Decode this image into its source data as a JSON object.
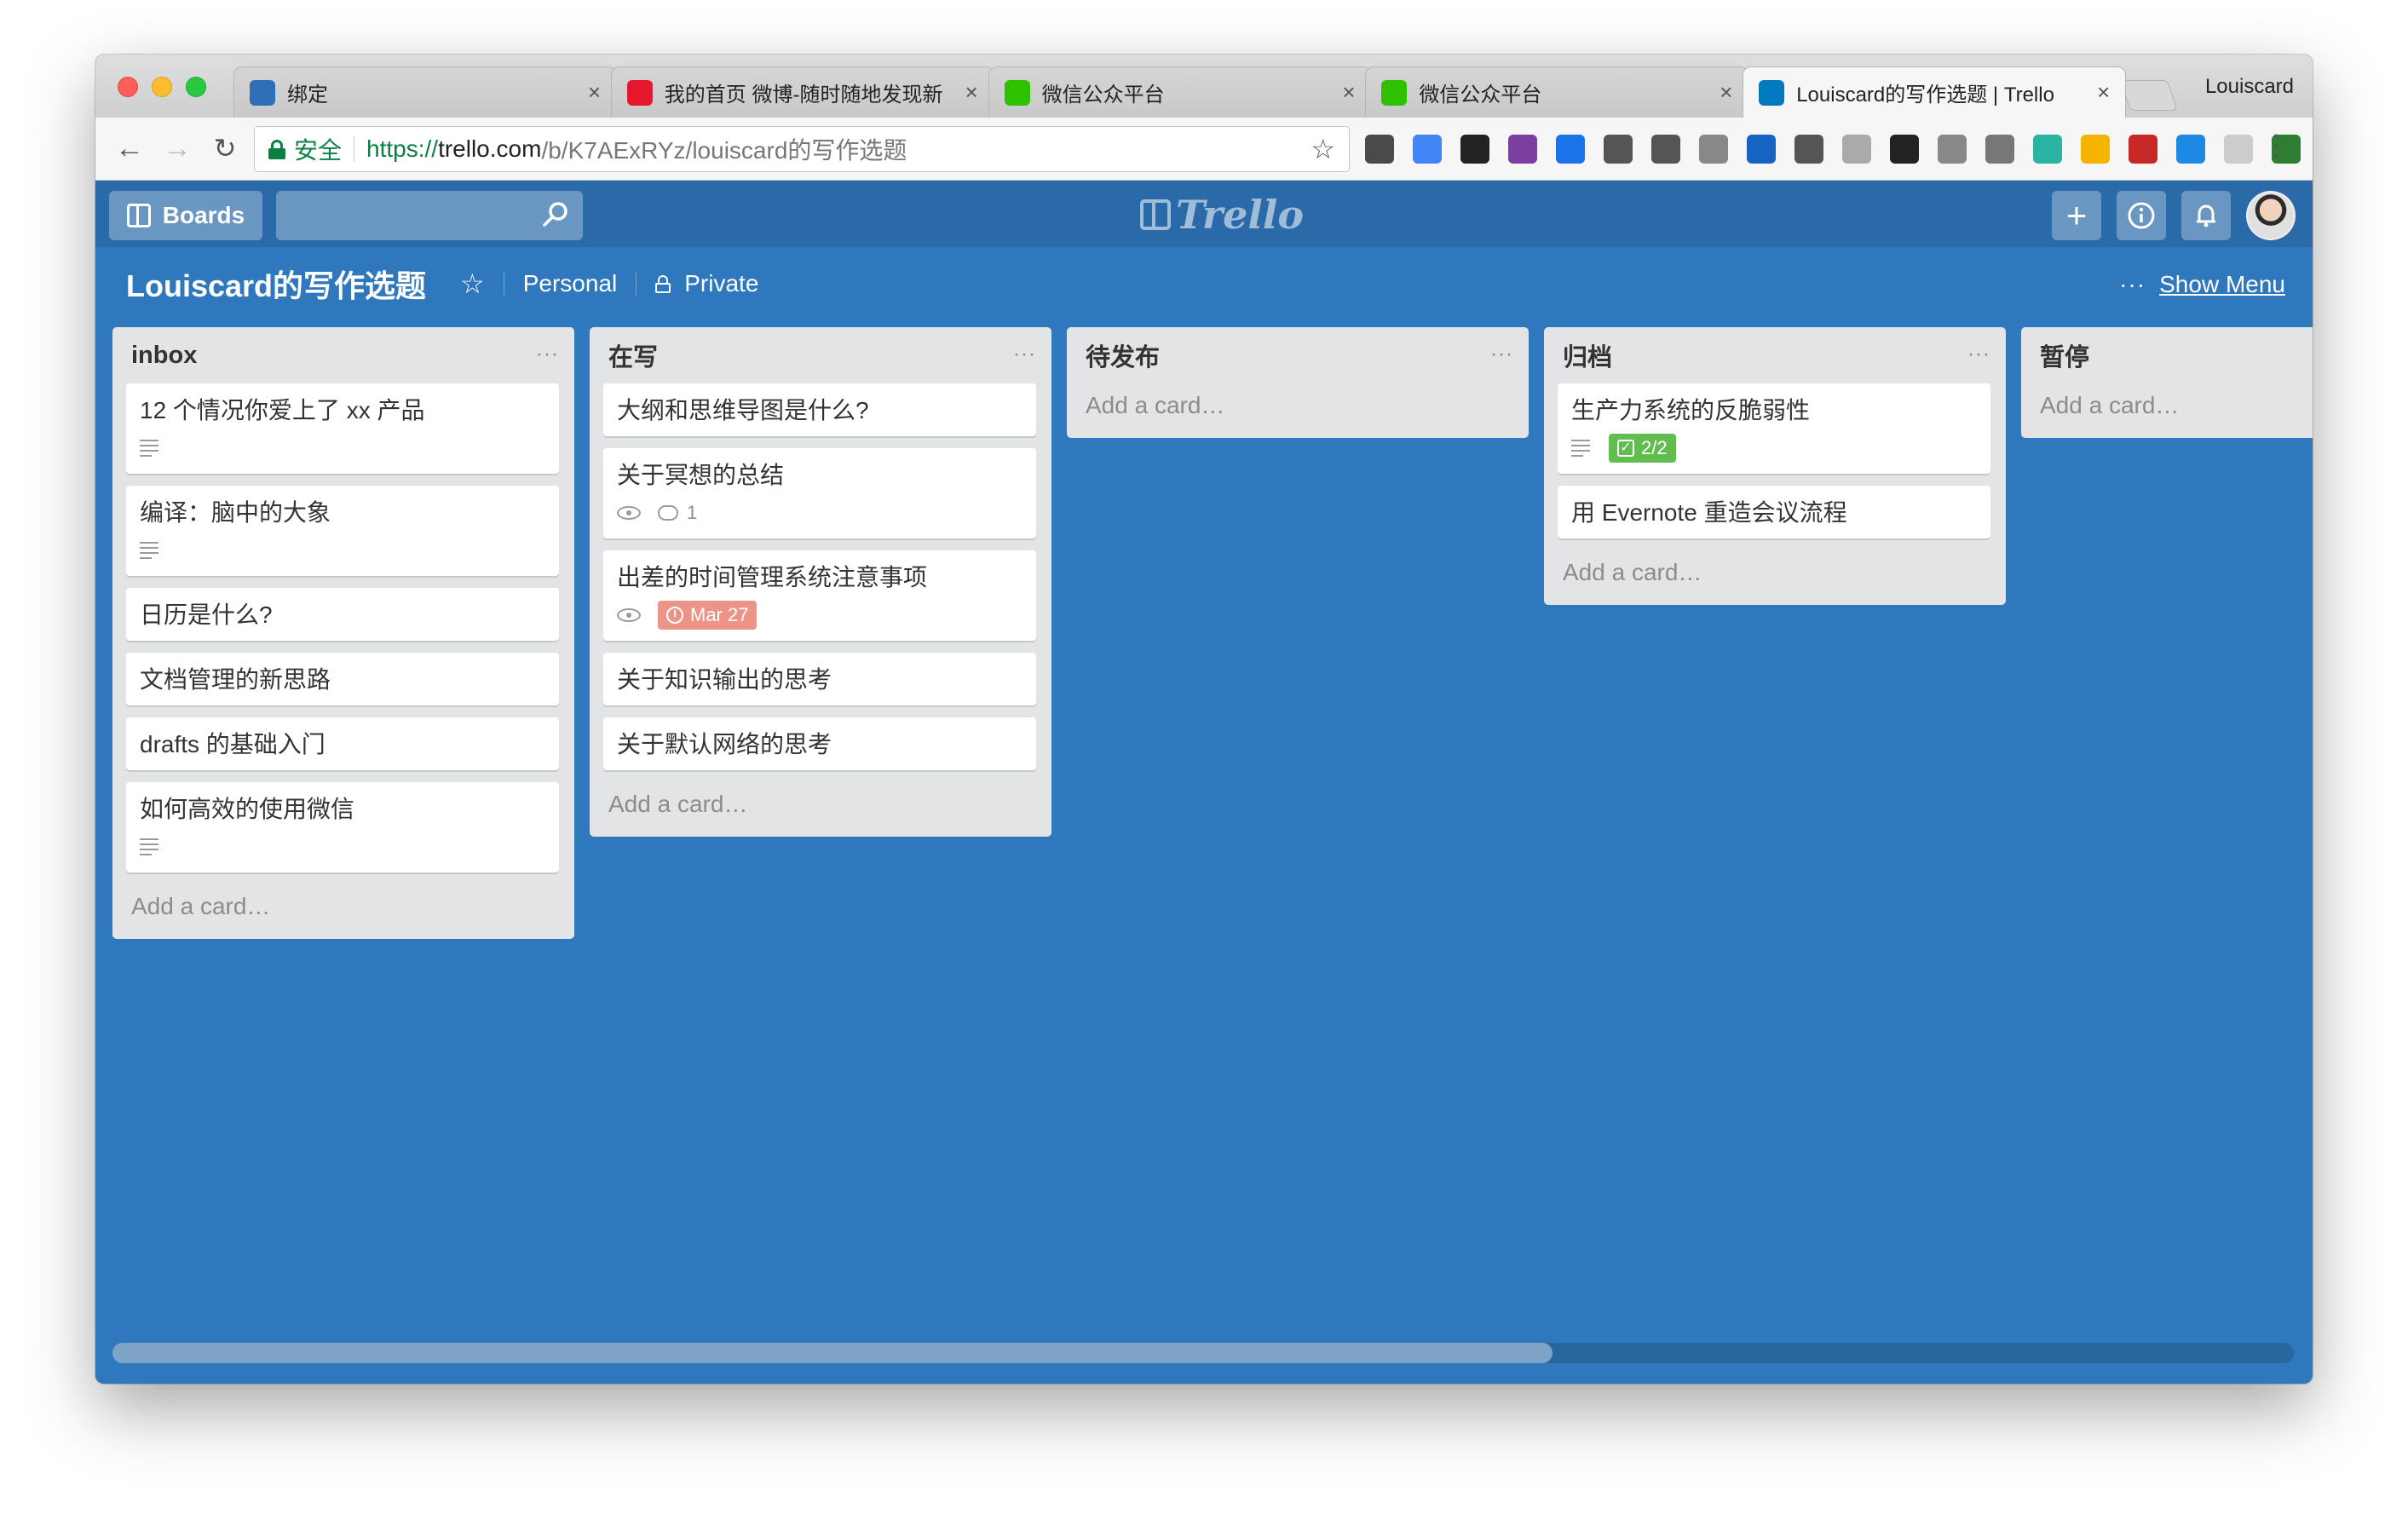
{
  "browser": {
    "tabs": [
      {
        "title": "绑定",
        "favicon_color": "#2f6fb7",
        "active": false
      },
      {
        "title": "我的首页 微博-随时随地发现新",
        "favicon_color": "#e6162d",
        "active": false
      },
      {
        "title": "微信公众平台",
        "favicon_color": "#2dc100",
        "active": false
      },
      {
        "title": "微信公众平台",
        "favicon_color": "#2dc100",
        "active": false
      },
      {
        "title": "Louiscard的写作选题 | Trello",
        "favicon_color": "#0079bf",
        "active": true
      }
    ],
    "close_glyph": "×",
    "profile_name": "Louiscard",
    "secure_label": "安全",
    "url_scheme": "https://",
    "url_host": "trello.com",
    "url_path": "/b/K7AExRYz/louiscard的写作选题",
    "extensions": [
      "evernote-icon",
      "translate-icon",
      "wechat-icon",
      "onenote-icon",
      "chrome-icon",
      "onepassword-icon",
      "lightbulb-icon",
      "reader-icon",
      "vimium-icon",
      "cloud-icon",
      "tab-icon",
      "instapaper-icon",
      "drive-icon",
      "inbox-icon",
      "refresh-icon",
      "folder-icon",
      "adblock-icon",
      "sync-icon",
      "shield-icon",
      "flag-icon",
      "trello-icon"
    ]
  },
  "trello": {
    "boards_label": "Boards",
    "logo_text": "Trello"
  },
  "board": {
    "title": "Louiscard的写作选题",
    "team": "Personal",
    "visibility": "Private",
    "show_menu": "Show Menu",
    "menu_dots": "···"
  },
  "lists": [
    {
      "title": "inbox",
      "cards": [
        {
          "title": "12 个情况你爱上了 xx 产品",
          "desc": true
        },
        {
          "title": "编译：脑中的大象",
          "desc": true
        },
        {
          "title": "日历是什么?"
        },
        {
          "title": "文档管理的新思路"
        },
        {
          "title": "drafts 的基础入门"
        },
        {
          "title": "如何高效的使用微信",
          "desc": true
        }
      ],
      "add_card": "Add a card…"
    },
    {
      "title": "在写",
      "cards": [
        {
          "title": "大纲和思维导图是什么?"
        },
        {
          "title": "关于冥想的总结",
          "watch": true,
          "comments": "1"
        },
        {
          "title": "出差的时间管理系统注意事项",
          "watch": true,
          "due": "Mar 27"
        },
        {
          "title": "关于知识输出的思考"
        },
        {
          "title": "关于默认网络的思考"
        }
      ],
      "add_card": "Add a card…"
    },
    {
      "title": "待发布",
      "cards": [],
      "add_card": "Add a card…"
    },
    {
      "title": "归档",
      "cards": [
        {
          "title": "生产力系统的反脆弱性",
          "desc": true,
          "checklist": "2/2"
        },
        {
          "title": "用 Evernote 重造会议流程"
        }
      ],
      "add_card": "Add a card…"
    },
    {
      "title": "暂停",
      "cards": [],
      "add_card": "Add a card…"
    }
  ],
  "colors": {
    "board_bg": "#2f78bd",
    "header_bg": "#2a6aa8",
    "list_bg": "#e2e4e6",
    "due_badge": "#ec9488",
    "checklist_badge": "#61bd4f"
  },
  "scroll": {
    "thumb_fraction": 0.66
  }
}
